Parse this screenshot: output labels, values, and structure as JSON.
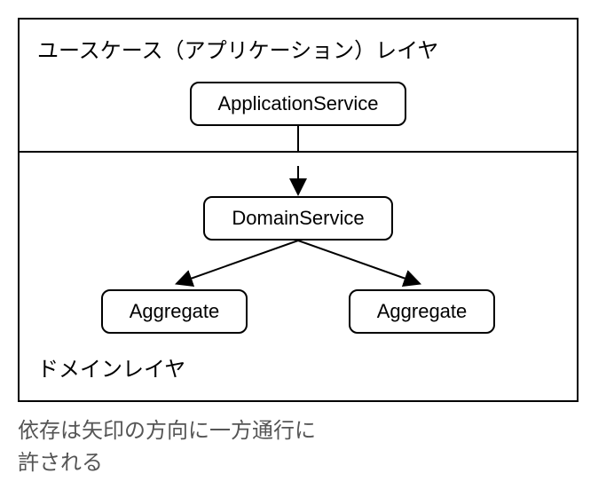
{
  "layers": {
    "usecase": {
      "title": "ユースケース（アプリケーション）レイヤ",
      "nodes": {
        "application_service": "ApplicationService"
      }
    },
    "domain": {
      "title": "ドメインレイヤ",
      "nodes": {
        "domain_service": "DomainService",
        "aggregate_left": "Aggregate",
        "aggregate_right": "Aggregate"
      }
    }
  },
  "caption": {
    "line1": "依存は矢印の方向に一方通行に",
    "line2": "許される"
  }
}
